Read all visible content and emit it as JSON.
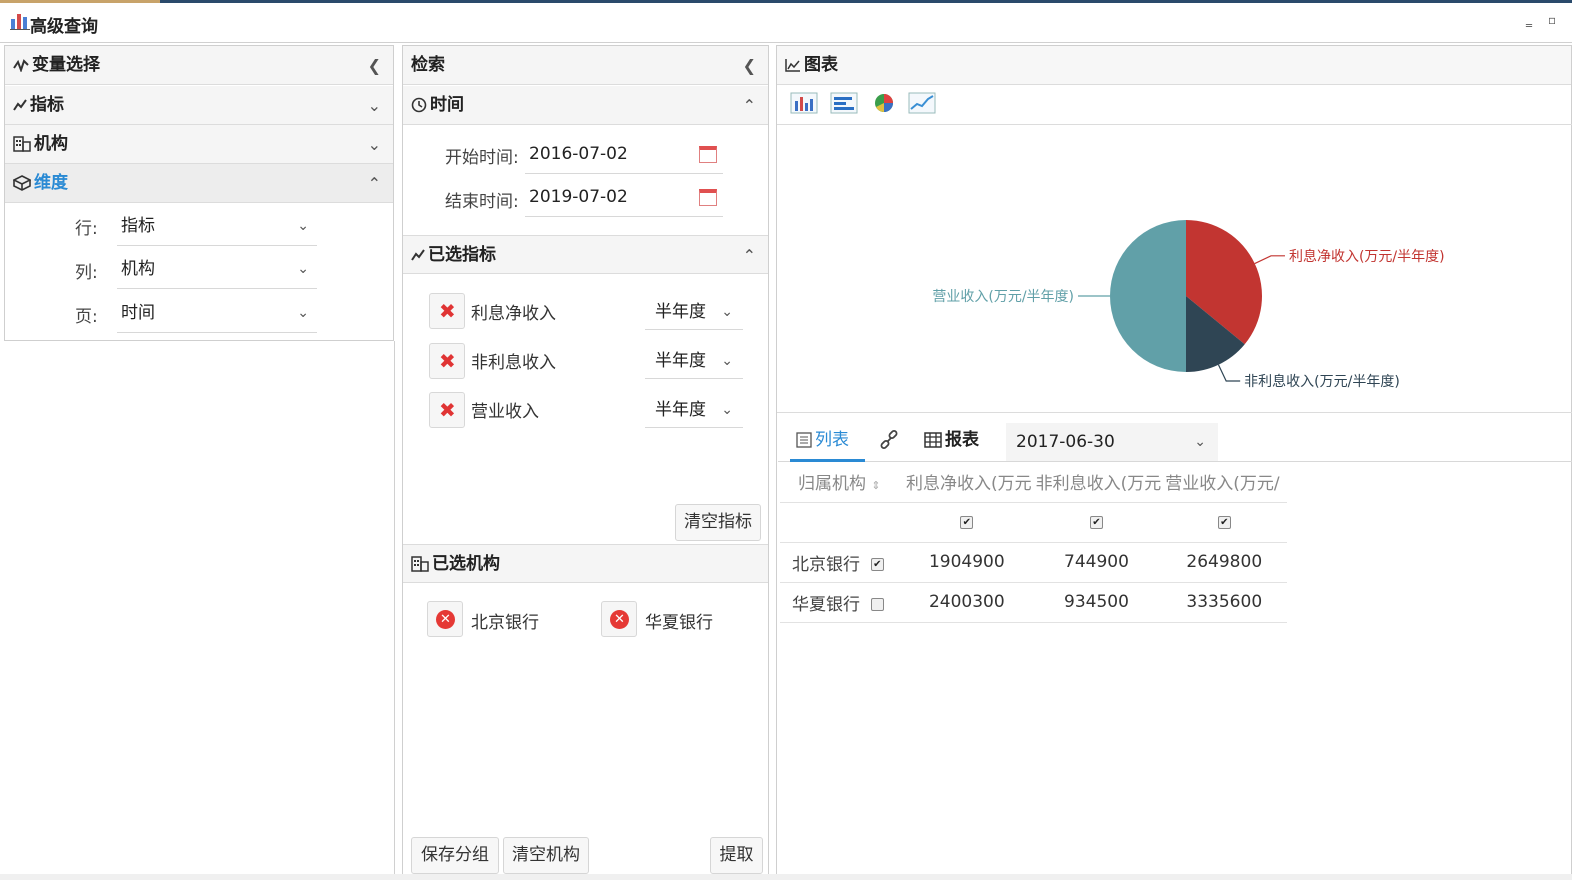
{
  "window": {
    "title": "高级查询",
    "minimize": "‗",
    "restore": "▫"
  },
  "left": {
    "header": "变量选择",
    "sections": [
      {
        "label": "指标"
      },
      {
        "label": "机构"
      },
      {
        "label": "维度"
      }
    ],
    "dims": [
      {
        "label": "行:",
        "value": "指标"
      },
      {
        "label": "列:",
        "value": "机构"
      },
      {
        "label": "页:",
        "value": "时间"
      }
    ]
  },
  "middle": {
    "header": "检索",
    "time": {
      "header": "时间",
      "start_label": "开始时间:",
      "start_value": "2016-07-02",
      "end_label": "结束时间:",
      "end_value": "2019-07-02"
    },
    "indicators": {
      "header": "已选指标",
      "items": [
        {
          "name": "利息净收入",
          "period": "半年度"
        },
        {
          "name": "非利息收入",
          "period": "半年度"
        },
        {
          "name": "营业收入",
          "period": "半年度"
        }
      ],
      "clear_button": "清空指标"
    },
    "institutions": {
      "header": "已选机构",
      "items": [
        {
          "name": "北京银行"
        },
        {
          "name": "华夏银行"
        }
      ]
    },
    "buttons": {
      "save_group": "保存分组",
      "clear_inst": "清空机构",
      "extract": "提取"
    }
  },
  "right": {
    "header": "图表",
    "tabs": {
      "list": "列表",
      "report": "报表"
    },
    "date_value": "2017-06-30",
    "table": {
      "headers": [
        "归属机构",
        "利息净收入(万元",
        "非利息收入(万元",
        "营业收入(万元/"
      ],
      "rows": [
        {
          "name": "北京银行",
          "checked": true,
          "values": [
            "1904900",
            "744900",
            "2649800"
          ]
        },
        {
          "name": "华夏银行",
          "checked": false,
          "values": [
            "2400300",
            "934500",
            "3335600"
          ]
        }
      ]
    }
  },
  "chart_data": {
    "type": "pie",
    "title": "",
    "slices": [
      {
        "label": "利息净收入(万元/半年度)",
        "value": 1904900,
        "color": "#c23531"
      },
      {
        "label": "非利息收入(万元/半年度)",
        "value": 744900,
        "color": "#2f4554"
      },
      {
        "label": "营业收入(万元/半年度)",
        "value": 2649800,
        "color": "#61a0a8"
      }
    ]
  }
}
